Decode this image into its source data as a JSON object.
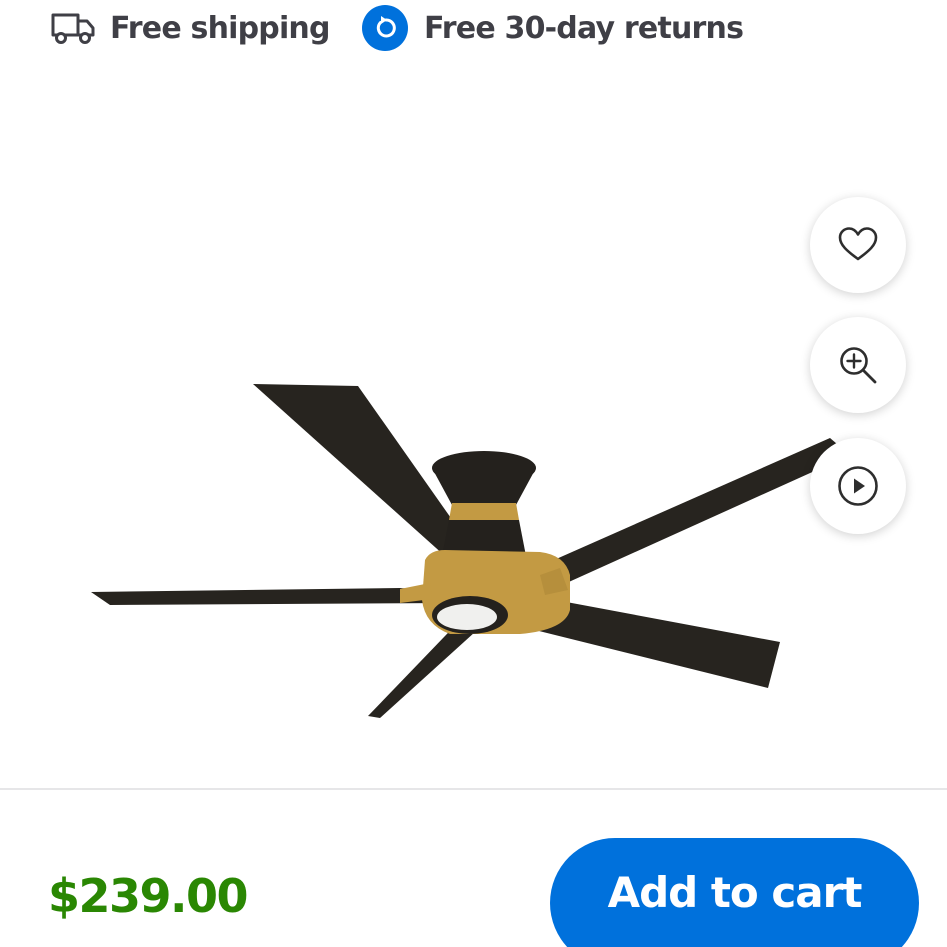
{
  "benefits": {
    "shipping": {
      "label": "Free shipping",
      "icon": "truck-icon"
    },
    "returns": {
      "label": "Free 30-day returns",
      "icon": "returns-icon"
    }
  },
  "product_image": {
    "actions": [
      {
        "name": "favorite",
        "icon": "heart-icon"
      },
      {
        "name": "zoom",
        "icon": "zoom-in-icon"
      },
      {
        "name": "video",
        "icon": "play-icon"
      }
    ]
  },
  "purchase": {
    "price": "$239.00",
    "add_to_cart_label": "Add to cart"
  },
  "colors": {
    "accent": "#0071dc",
    "price": "#2a8703",
    "text": "#3f3f46"
  }
}
